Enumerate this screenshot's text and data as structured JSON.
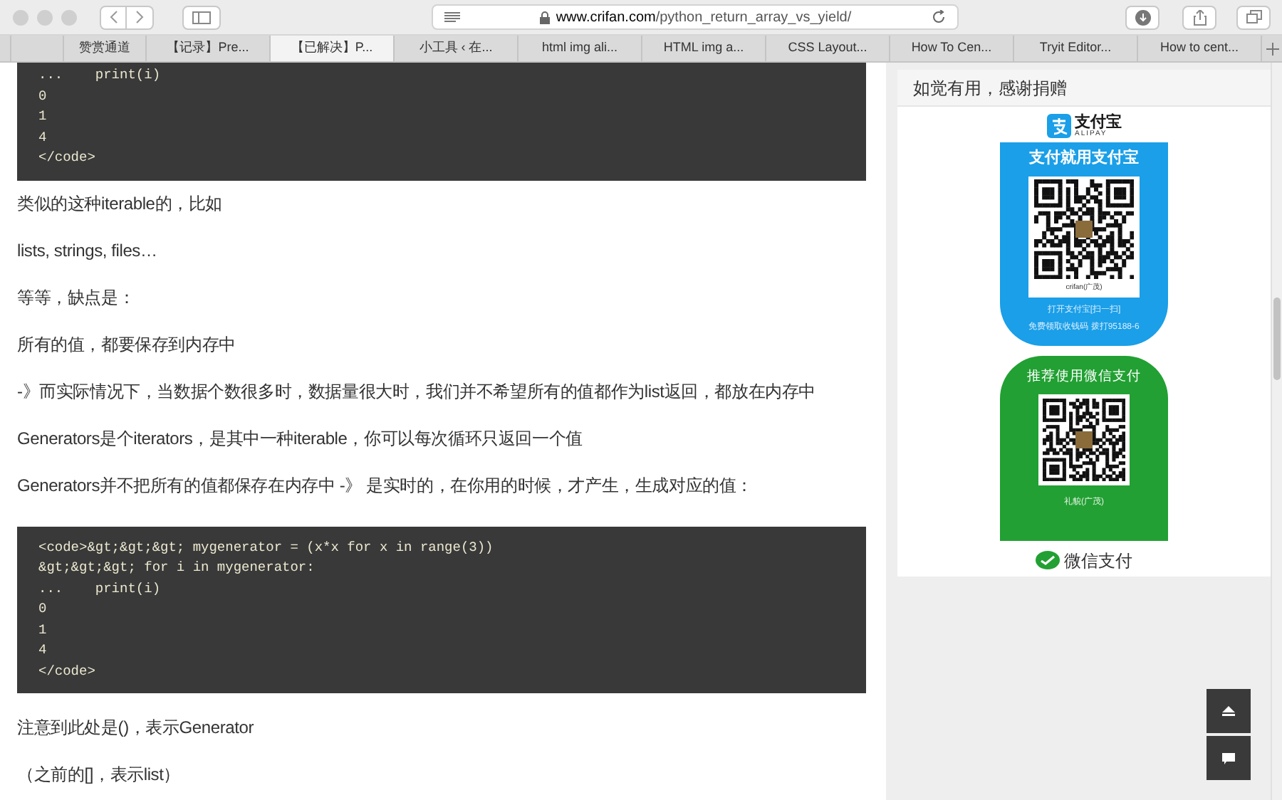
{
  "browser": {
    "url_host": "www.crifan.com",
    "url_path": "/python_return_array_vs_yield/"
  },
  "tabs": [
    {
      "label": "赞赏通道",
      "selected": false
    },
    {
      "label": "【记录】Pre...",
      "selected": false
    },
    {
      "label": "【已解决】P...",
      "selected": true
    },
    {
      "label": "小工具 ‹ 在...",
      "selected": false
    },
    {
      "label": "html img ali...",
      "selected": false
    },
    {
      "label": "HTML img a...",
      "selected": false
    },
    {
      "label": "CSS Layout...",
      "selected": false
    },
    {
      "label": "How To Cen...",
      "selected": false
    },
    {
      "label": "Tryit Editor...",
      "selected": false
    },
    {
      "label": "How to cent...",
      "selected": false
    }
  ],
  "article": [
    {
      "kind": "code",
      "lines": [
        "...    print(i)",
        "0",
        "1",
        "4",
        "</code>"
      ]
    },
    {
      "kind": "text",
      "text": "类似的这种iterable的，比如"
    },
    {
      "kind": "text",
      "text": "lists, strings, files…"
    },
    {
      "kind": "text",
      "text": "等等，缺点是："
    },
    {
      "kind": "text",
      "text": "所有的值，都要保存到内存中"
    },
    {
      "kind": "text",
      "text": "-》而实际情况下，当数据个数很多时，数据量很大时，我们并不希望所有的值都作为list返回，都放在内存中"
    },
    {
      "kind": "text",
      "text": "Generators是个iterators，是其中一种iterable，你可以每次循环只返回一个值"
    },
    {
      "kind": "text",
      "text": "Generators并不把所有的值都保存在内存中 -》 是实时的，在你用的时候，才产生，生成对应的值："
    },
    {
      "kind": "code",
      "lines": [
        "<code>&gt;&gt;&gt; mygenerator = (x*x for x in range(3))",
        "&gt;&gt;&gt; for i in mygenerator:",
        "...    print(i)",
        "0",
        "1",
        "4",
        "</code>"
      ]
    },
    {
      "kind": "text",
      "text": "注意到此处是()，表示Generator"
    },
    {
      "kind": "text",
      "text": "（之前的[]，表示list）"
    }
  ],
  "donate": {
    "title": "如觉有用，感谢捐赠",
    "alipay": {
      "logo_text": "支付宝",
      "logo_sub": "ALIPAY",
      "heading": "支付就用支付宝",
      "name": "crifan(广茂)",
      "hint": "打开支付宝[扫一扫]",
      "note": "免费领取收钱码 拨打95188-6"
    },
    "wechat": {
      "heading": "推荐使用微信支付",
      "name": "礼貌(广茂)",
      "footer": "微信支付"
    }
  }
}
